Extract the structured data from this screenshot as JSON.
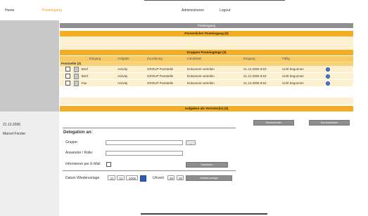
{
  "topnav": {
    "home": "Home",
    "posteingang": "Posteingang",
    "administrieren": "Administrieren",
    "logout": "Logout"
  },
  "sidebar": {
    "date": "21.12.2006",
    "user": "Marcel Forster"
  },
  "sections": {
    "posteingang": "Posteingang",
    "personal": "Persönlicher Posteingang (0)",
    "group": "Gruppen Posteingänge (3)",
    "deputy": "Aufgaben als Vertreter(in) (0)"
  },
  "table": {
    "columns": [
      "Eingang",
      "Aufgabe",
      "Zuordnung",
      "Inhaltstitel",
      "Eingang",
      "Fällig"
    ],
    "group_title": "Poststelle (3)",
    "rows": [
      {
        "type": "Brief",
        "task": "Activity",
        "assignment": "GROUP Poststelle",
        "title": "Dokument verteilen",
        "received": "21.12.2006 8:53",
        "due": "nicht begonnen"
      },
      {
        "type": "Brief",
        "task": "Activity",
        "assignment": "GROUP Poststelle",
        "title": "Dokument verteilen",
        "received": "21.12.2006 8:53",
        "due": "nicht begonnen"
      },
      {
        "type": "Fax",
        "task": "Activity",
        "assignment": "GROUP Poststelle",
        "title": "Dokument verteilen",
        "received": "21.12.2006 8:53",
        "due": "nicht begonnen"
      }
    ],
    "info_glyph": "i"
  },
  "buttons": {
    "accept": "Übernehmen",
    "deleg": "Zurückweisen",
    "assign": "Zuweisen",
    "wiedervorlage": "Wiedervorlage"
  },
  "delegation": {
    "title": "Delegation an:",
    "gruppe_label": "Gruppe:",
    "gruppe_value": "",
    "browse_label": "...",
    "anwender_label": "Anwender / Rolle:",
    "anwender_value": "",
    "email_label": "Informieren per E-Mail",
    "date_label": "Datum Wiedervorlage",
    "day": "21",
    "month": "12",
    "year": "2006",
    "time_label": "Uhrzeit",
    "hour": "00",
    "minute": "00"
  }
}
